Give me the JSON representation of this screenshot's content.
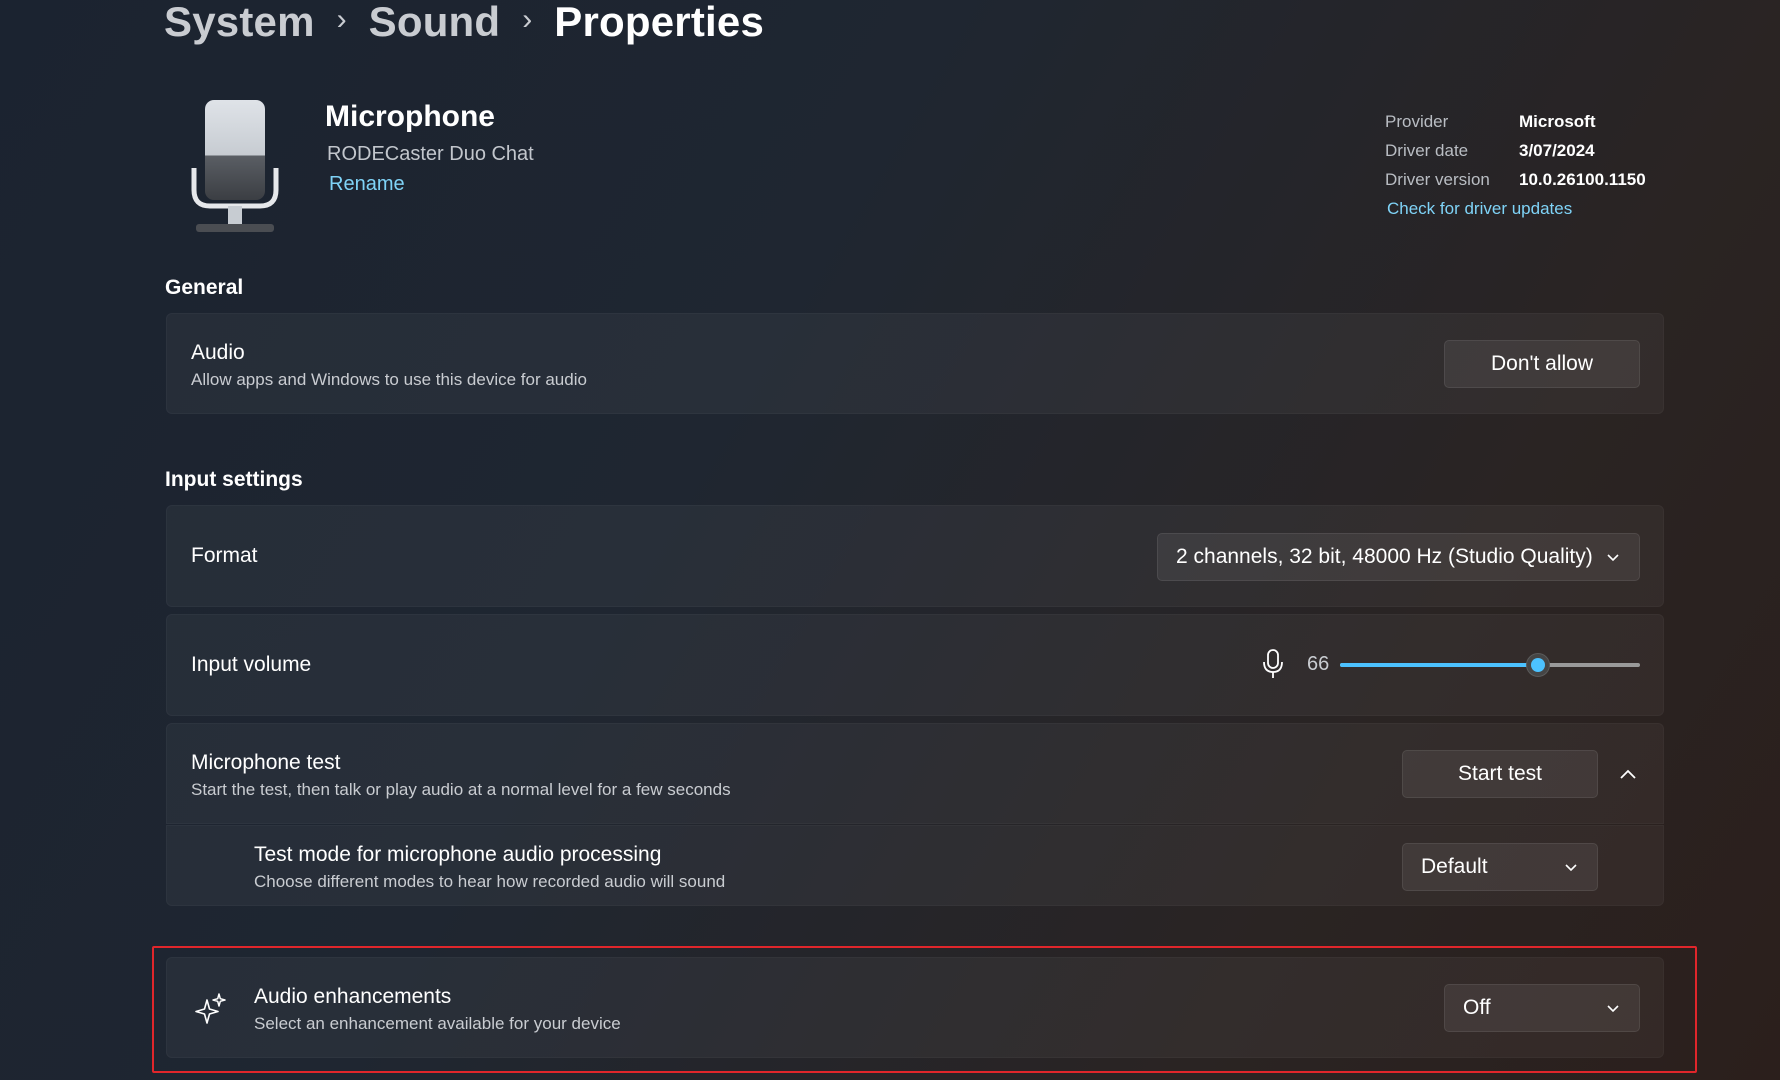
{
  "breadcrumb": {
    "items": [
      "System",
      "Sound",
      "Properties"
    ],
    "separator": "›"
  },
  "device": {
    "name": "Microphone",
    "model": "RODECaster Duo Chat",
    "rename_label": "Rename",
    "icon": "microphone-device-icon"
  },
  "driver": {
    "provider_label": "Provider",
    "provider_value": "Microsoft",
    "date_label": "Driver date",
    "date_value": "3/07/2024",
    "version_label": "Driver version",
    "version_value": "10.0.26100.1150",
    "update_link": "Check for driver updates"
  },
  "general": {
    "heading": "General",
    "audio": {
      "title": "Audio",
      "description": "Allow apps and Windows to use this device for audio",
      "button": "Don't allow"
    }
  },
  "input_settings": {
    "heading": "Input settings",
    "format": {
      "title": "Format",
      "selected": "2 channels, 32 bit, 48000 Hz (Studio Quality)"
    },
    "volume": {
      "title": "Input volume",
      "value": "66",
      "level": 0.66,
      "icon": "microphone-icon"
    },
    "mic_test": {
      "title": "Microphone test",
      "description": "Start the test, then talk or play audio at a normal level for a few seconds",
      "button": "Start test",
      "expanded": true
    },
    "test_mode": {
      "title": "Test mode for microphone audio processing",
      "description": "Choose different modes to hear how recorded audio will sound",
      "selected": "Default"
    }
  },
  "enhancements": {
    "title": "Audio enhancements",
    "description": "Select an enhancement available for your device",
    "selected": "Off",
    "icon": "sparkle-icon"
  },
  "colors": {
    "accent": "#4cc2ff",
    "link": "#7fd3f7",
    "highlight": "#e0262b"
  }
}
